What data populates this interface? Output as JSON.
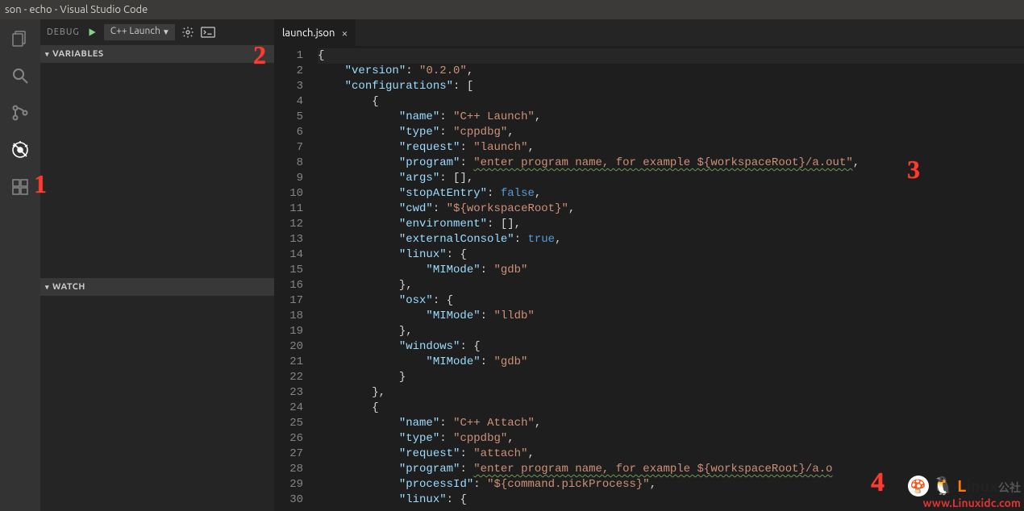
{
  "titlebar": "son - echo - Visual Studio Code",
  "activitybar": {
    "items": [
      "files-icon",
      "search-icon",
      "git-icon",
      "debug-icon",
      "extensions-icon"
    ],
    "active": 3
  },
  "debug": {
    "label": "DEBUG",
    "config_selected": "C++ Launch",
    "sections": {
      "variables": "VARIABLES",
      "watch": "WATCH"
    }
  },
  "tab": {
    "name": "launch.json"
  },
  "code_lines": [
    [
      [
        "punc",
        "{"
      ]
    ],
    [
      [
        "pad",
        "    "
      ],
      [
        "key",
        "\"version\""
      ],
      [
        "punc",
        ": "
      ],
      [
        "str",
        "\"0.2.0\""
      ],
      [
        "punc",
        ","
      ]
    ],
    [
      [
        "pad",
        "    "
      ],
      [
        "key",
        "\"configurations\""
      ],
      [
        "punc",
        ": ["
      ]
    ],
    [
      [
        "pad",
        "        "
      ],
      [
        "punc",
        "{"
      ]
    ],
    [
      [
        "pad",
        "            "
      ],
      [
        "key",
        "\"name\""
      ],
      [
        "punc",
        ": "
      ],
      [
        "str",
        "\"C++ Launch\""
      ],
      [
        "punc",
        ","
      ]
    ],
    [
      [
        "pad",
        "            "
      ],
      [
        "key",
        "\"type\""
      ],
      [
        "punc",
        ": "
      ],
      [
        "str",
        "\"cppdbg\""
      ],
      [
        "punc",
        ","
      ]
    ],
    [
      [
        "pad",
        "            "
      ],
      [
        "key",
        "\"request\""
      ],
      [
        "punc",
        ": "
      ],
      [
        "str",
        "\"launch\""
      ],
      [
        "punc",
        ","
      ]
    ],
    [
      [
        "pad",
        "            "
      ],
      [
        "key",
        "\"program\""
      ],
      [
        "punc",
        ": "
      ],
      [
        "strsq",
        "\"enter program name, for example ${workspaceRoot}/a.out\""
      ],
      [
        "punc",
        ","
      ]
    ],
    [
      [
        "pad",
        "            "
      ],
      [
        "key",
        "\"args\""
      ],
      [
        "punc",
        ": [],"
      ]
    ],
    [
      [
        "pad",
        "            "
      ],
      [
        "key",
        "\"stopAtEntry\""
      ],
      [
        "punc",
        ": "
      ],
      [
        "bool",
        "false"
      ],
      [
        "punc",
        ","
      ]
    ],
    [
      [
        "pad",
        "            "
      ],
      [
        "key",
        "\"cwd\""
      ],
      [
        "punc",
        ": "
      ],
      [
        "str",
        "\"${workspaceRoot}\""
      ],
      [
        "punc",
        ","
      ]
    ],
    [
      [
        "pad",
        "            "
      ],
      [
        "key",
        "\"environment\""
      ],
      [
        "punc",
        ": [],"
      ]
    ],
    [
      [
        "pad",
        "            "
      ],
      [
        "key",
        "\"externalConsole\""
      ],
      [
        "punc",
        ": "
      ],
      [
        "bool",
        "true"
      ],
      [
        "punc",
        ","
      ]
    ],
    [
      [
        "pad",
        "            "
      ],
      [
        "key",
        "\"linux\""
      ],
      [
        "punc",
        ": {"
      ]
    ],
    [
      [
        "pad",
        "                "
      ],
      [
        "key",
        "\"MIMode\""
      ],
      [
        "punc",
        ": "
      ],
      [
        "str",
        "\"gdb\""
      ]
    ],
    [
      [
        "pad",
        "            "
      ],
      [
        "punc",
        "},"
      ]
    ],
    [
      [
        "pad",
        "            "
      ],
      [
        "key",
        "\"osx\""
      ],
      [
        "punc",
        ": {"
      ]
    ],
    [
      [
        "pad",
        "                "
      ],
      [
        "key",
        "\"MIMode\""
      ],
      [
        "punc",
        ": "
      ],
      [
        "str",
        "\"lldb\""
      ]
    ],
    [
      [
        "pad",
        "            "
      ],
      [
        "punc",
        "},"
      ]
    ],
    [
      [
        "pad",
        "            "
      ],
      [
        "key",
        "\"windows\""
      ],
      [
        "punc",
        ": {"
      ]
    ],
    [
      [
        "pad",
        "                "
      ],
      [
        "key",
        "\"MIMode\""
      ],
      [
        "punc",
        ": "
      ],
      [
        "str",
        "\"gdb\""
      ]
    ],
    [
      [
        "pad",
        "            "
      ],
      [
        "punc",
        "}"
      ]
    ],
    [
      [
        "pad",
        "        "
      ],
      [
        "punc",
        "},"
      ]
    ],
    [
      [
        "pad",
        "        "
      ],
      [
        "punc",
        "{"
      ]
    ],
    [
      [
        "pad",
        "            "
      ],
      [
        "key",
        "\"name\""
      ],
      [
        "punc",
        ": "
      ],
      [
        "str",
        "\"C++ Attach\""
      ],
      [
        "punc",
        ","
      ]
    ],
    [
      [
        "pad",
        "            "
      ],
      [
        "key",
        "\"type\""
      ],
      [
        "punc",
        ": "
      ],
      [
        "str",
        "\"cppdbg\""
      ],
      [
        "punc",
        ","
      ]
    ],
    [
      [
        "pad",
        "            "
      ],
      [
        "key",
        "\"request\""
      ],
      [
        "punc",
        ": "
      ],
      [
        "str",
        "\"attach\""
      ],
      [
        "punc",
        ","
      ]
    ],
    [
      [
        "pad",
        "            "
      ],
      [
        "key",
        "\"program\""
      ],
      [
        "punc",
        ": "
      ],
      [
        "strsq",
        "\"enter program name, for example ${workspaceRoot}/a.o"
      ]
    ],
    [
      [
        "pad",
        "            "
      ],
      [
        "key",
        "\"processId\""
      ],
      [
        "punc",
        ": "
      ],
      [
        "str",
        "\"${command.pickProcess}\""
      ],
      [
        "punc",
        ","
      ]
    ],
    [
      [
        "pad",
        "            "
      ],
      [
        "key",
        "\"linux\""
      ],
      [
        "punc",
        ": {"
      ]
    ]
  ],
  "annotations": {
    "a1": "1",
    "a2": "2",
    "a3": "3",
    "a4": "4"
  },
  "watermark": {
    "brand1": "L",
    "brand2": "inux",
    "brand3": "公社",
    "url": "www.Linuxidc.com"
  }
}
